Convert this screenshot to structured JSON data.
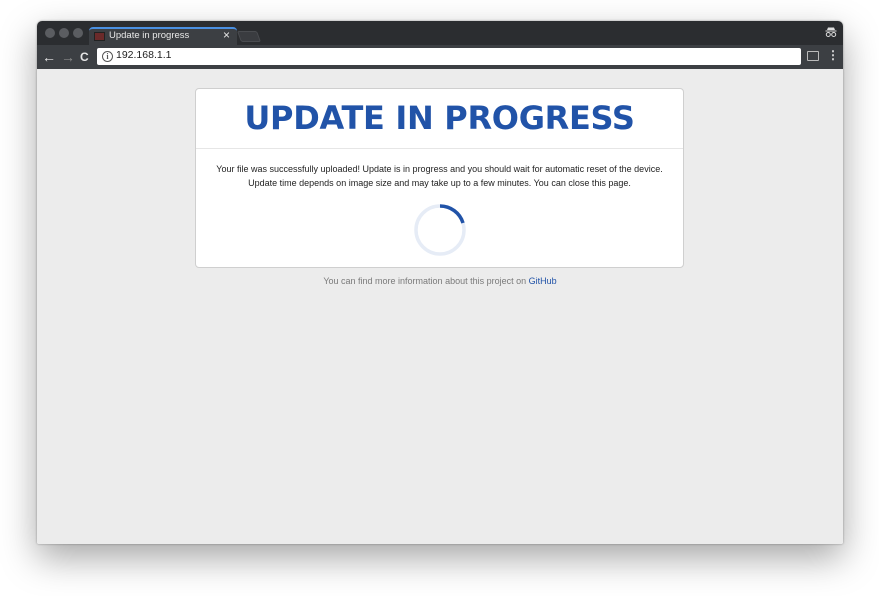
{
  "browser": {
    "tab_title": "Update in progress",
    "tab_close": "×",
    "url": "192.168.1.1",
    "info_icon": "i",
    "back_glyph": "←",
    "forward_glyph": "→",
    "reload_glyph": "C",
    "menu_glyph": "⋮"
  },
  "card": {
    "title": "UPDATE IN PROGRESS",
    "message_line1": "Your file was successfully uploaded! Update is in progress and you should wait for automatic reset of the device.",
    "message_line2": "Update time depends on image size and may take up to a few minutes. You can close this page."
  },
  "footer": {
    "text": "You can find more information about this project on",
    "link_label": "GitHub"
  },
  "colors": {
    "accent": "#2153a8",
    "spinner_track": "#e6ecf6",
    "page_bg": "#ececec"
  }
}
